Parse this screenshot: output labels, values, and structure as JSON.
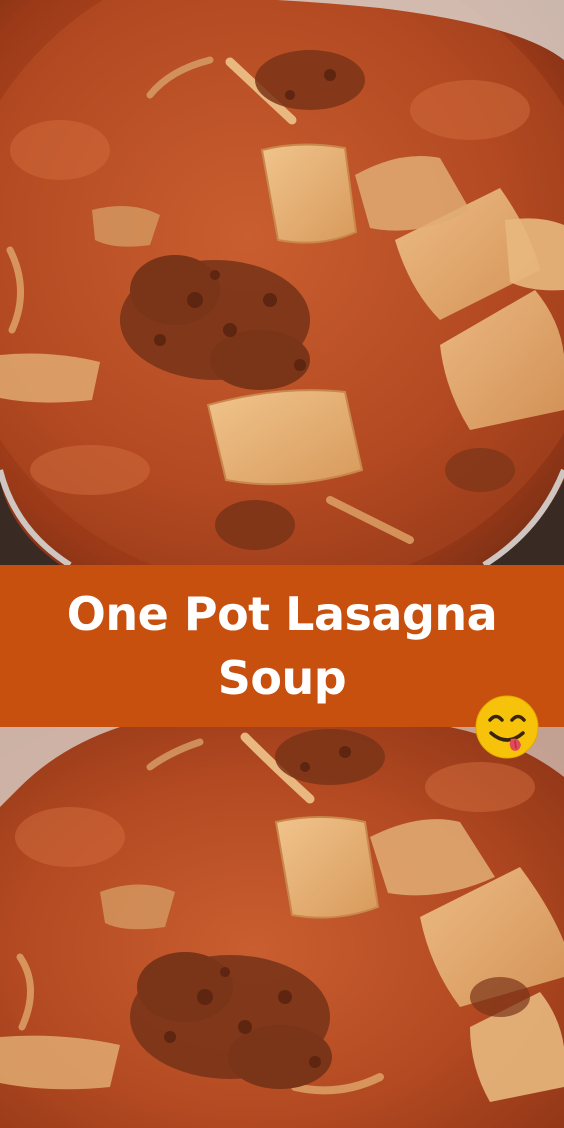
{
  "title_lines": [
    "One Pot Lasagna",
    "Soup"
  ],
  "emoji_icon": "face-savoring-food-icon",
  "colors": {
    "banner": "#c8500e",
    "title_text": "#ffffff",
    "sauce": "#b44a22",
    "noodle": "#e6b47a",
    "meat": "#7a3418",
    "pot_rim": "#d9cfc8",
    "emoji_face": "#f7c20a"
  }
}
